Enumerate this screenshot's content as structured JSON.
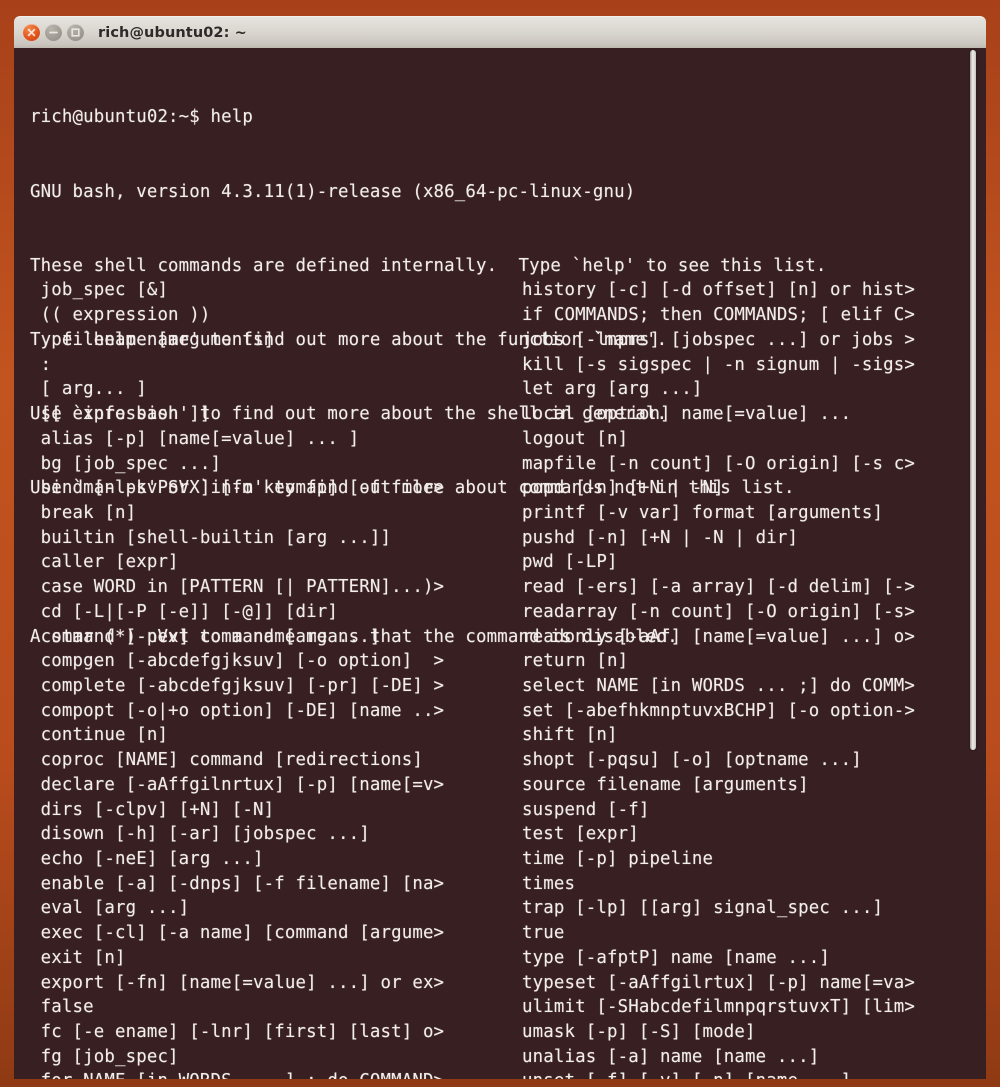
{
  "window": {
    "title": "rich@ubuntu02: ~",
    "controls": [
      {
        "name": "close",
        "label": "Close"
      },
      {
        "name": "minimize",
        "label": "Minimize"
      },
      {
        "name": "maximize",
        "label": "Maximize"
      }
    ],
    "accent_color": "#c2541f",
    "titlebar_color": "#dbd7d1",
    "terminal_background": "#371f22",
    "terminal_foreground": "#f2eeec"
  },
  "terminal": {
    "prompt_line": "rich@ubuntu02:~$ help",
    "header_lines": [
      "GNU bash, version 4.3.11(1)-release (x86_64-pc-linux-gnu)",
      "These shell commands are defined internally.  Type `help' to see this list.",
      "Type `help name' to find out more about the function `name'.",
      "Use `info bash' to find out more about the shell in general.",
      "Use `man -k' or `info' to find out more about commands not in this list.",
      "",
      "A star (*) next to a name means that the command is disabled.",
      ""
    ],
    "builtins_left": [
      " job_spec [&]",
      " (( expression ))",
      " . filename [arguments]",
      " :",
      " [ arg... ]",
      " [[ expression ]]",
      " alias [-p] [name[=value] ... ]",
      " bg [job_spec ...]",
      " bind [-lpsvPSVX] [-m keymap] [-f file>",
      " break [n]",
      " builtin [shell-builtin [arg ...]]",
      " caller [expr]",
      " case WORD in [PATTERN [| PATTERN]...)>",
      " cd [-L|[-P [-e]] [-@]] [dir]",
      " command [-pVv] command [arg ...]",
      " compgen [-abcdefgjksuv] [-o option]  >",
      " complete [-abcdefgjksuv] [-pr] [-DE] >",
      " compopt [-o|+o option] [-DE] [name ..>",
      " continue [n]",
      " coproc [NAME] command [redirections]",
      " declare [-aAffgilnrtux] [-p] [name[=v>",
      " dirs [-clpv] [+N] [-N]",
      " disown [-h] [-ar] [jobspec ...]",
      " echo [-neE] [arg ...]",
      " enable [-a] [-dnps] [-f filename] [na>",
      " eval [arg ...]",
      " exec [-cl] [-a name] [command [argume>",
      " exit [n]",
      " export [-fn] [name[=value] ...] or ex>",
      " false",
      " fc [-e ename] [-lnr] [first] [last] o>",
      " fg [job_spec]",
      " for NAME [in WORDS ... ] ; do COMMAND>"
    ],
    "builtins_right": [
      "history [-c] [-d offset] [n] or hist>",
      "if COMMANDS; then COMMANDS; [ elif C>",
      "jobs [-lnprs] [jobspec ...] or jobs >",
      "kill [-s sigspec | -n signum | -sigs>",
      "let arg [arg ...]",
      "local [option] name[=value] ...",
      "logout [n]",
      "mapfile [-n count] [-O origin] [-s c>",
      "popd [-n] [+N | -N]",
      "printf [-v var] format [arguments]",
      "pushd [-n] [+N | -N | dir]",
      "pwd [-LP]",
      "read [-ers] [-a array] [-d delim] [->",
      "readarray [-n count] [-O origin] [-s>",
      "readonly [-aAf] [name[=value] ...] o>",
      "return [n]",
      "select NAME [in WORDS ... ;] do COMM>",
      "set [-abefhkmnptuvxBCHP] [-o option->",
      "shift [n]",
      "shopt [-pqsu] [-o] [optname ...]",
      "source filename [arguments]",
      "suspend [-f]",
      "test [expr]",
      "time [-p] pipeline",
      "times",
      "trap [-lp] [[arg] signal_spec ...]",
      "true",
      "type [-afptP] name [name ...]",
      "typeset [-aAffgilrtux] [-p] name[=va>",
      "ulimit [-SHabcdefilmnpqrstuvxT] [lim>",
      "umask [-p] [-S] [mode]",
      "unalias [-a] name [name ...]",
      "unset [-f] [-v] [-n] [name ...]"
    ]
  }
}
